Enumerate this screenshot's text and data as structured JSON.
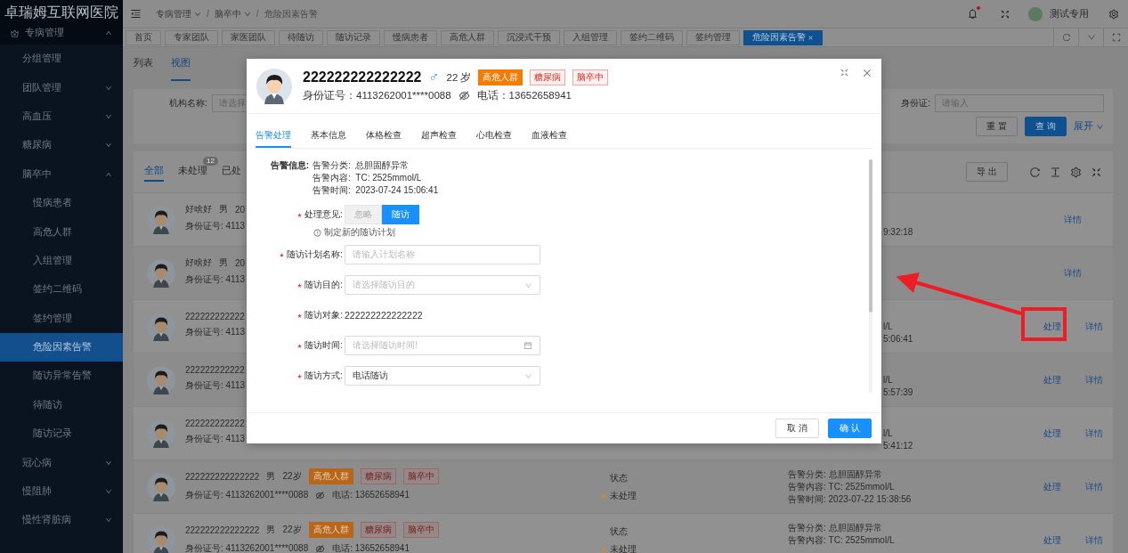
{
  "sidebar": {
    "title": "卓瑞姆互联网医院",
    "items": [
      {
        "label": "专病管理",
        "expanded": true,
        "selected": false,
        "children": [
          {
            "label": "分组管理",
            "selected": false
          },
          {
            "label": "团队管理",
            "expanded": false,
            "selected": false
          },
          {
            "label": "高血压",
            "expanded": false,
            "selected": false
          },
          {
            "label": "糖尿病",
            "expanded": false,
            "selected": false
          },
          {
            "label": "脑卒中",
            "expanded": true,
            "selected": false,
            "children": [
              {
                "label": "慢病患者",
                "selected": false
              },
              {
                "label": "高危人群",
                "selected": false
              },
              {
                "label": "入组管理",
                "selected": false
              },
              {
                "label": "签约二维码",
                "selected": false
              },
              {
                "label": "签约管理",
                "selected": false
              },
              {
                "label": "危险因素告警",
                "selected": true
              },
              {
                "label": "随访异常告警",
                "selected": false
              },
              {
                "label": "待随访",
                "selected": false
              },
              {
                "label": "随访记录",
                "selected": false
              }
            ]
          },
          {
            "label": "冠心病",
            "expanded": false,
            "selected": false
          },
          {
            "label": "慢阻肺",
            "expanded": false,
            "selected": false
          },
          {
            "label": "慢性肾脏病",
            "expanded": false,
            "selected": false
          }
        ]
      }
    ]
  },
  "header": {
    "breadcrumb": [
      {
        "label": "专病管理",
        "dropdown": true
      },
      {
        "separator": "/",
        "label": "脑卒中",
        "dropdown": true
      },
      {
        "separator": "/",
        "label": "危险因素告警",
        "dropdown": false
      }
    ],
    "notification": true,
    "user": "测试专用",
    "tabs": [
      {
        "label": "首页",
        "selected": false
      },
      {
        "label": "专家团队",
        "selected": false
      },
      {
        "label": "家医团队",
        "selected": false
      },
      {
        "label": "待随访",
        "selected": false
      },
      {
        "label": "随访记录",
        "selected": false
      },
      {
        "label": "慢病患者",
        "selected": false
      },
      {
        "label": "高危人群",
        "selected": false
      },
      {
        "label": "沉浸式干预",
        "selected": false
      },
      {
        "label": "入组管理",
        "selected": false
      },
      {
        "label": "签约二维码",
        "selected": false
      },
      {
        "label": "签约管理",
        "selected": false
      },
      {
        "label": "危险因素告警",
        "selected": true
      }
    ]
  },
  "view_tabs": [
    {
      "label": "列表",
      "selected": false
    },
    {
      "label": "视图",
      "selected": true
    }
  ],
  "filter": {
    "fields": [
      {
        "label": "机构名称:",
        "placeholder": "请选择",
        "kind": "select"
      },
      {
        "label": "身份证:",
        "placeholder": "请输入",
        "kind": "input"
      }
    ],
    "buttons": [
      {
        "label": "重 置",
        "primary": false
      },
      {
        "label": "查 询",
        "primary": true
      }
    ],
    "expand": "展开"
  },
  "list": {
    "tabs": [
      {
        "label": "全部",
        "selected": true
      },
      {
        "label": "未处理",
        "selected": false,
        "badge": "12"
      },
      {
        "label": "已处",
        "selected": false
      }
    ],
    "export": "导 出",
    "rows": [
      {
        "kind": "covered",
        "name": "好啥好",
        "gender": "男",
        "age": "20",
        "id": "身份证号: 4113",
        "tail": {
          "time": "9:32:18"
        },
        "actions": [
          "详情"
        ]
      },
      {
        "kind": "covered",
        "name": "好啥好",
        "gender": "男",
        "age": "20",
        "id": "身份证号: 4113",
        "actions": [
          "详情"
        ]
      },
      {
        "kind": "covered",
        "name": "222222222222",
        "id": "身份证号: 4113",
        "tail": {
          "content": "l/L",
          "time": "5:06:41"
        },
        "actions": [
          "处理",
          "详情"
        ]
      },
      {
        "kind": "covered",
        "name": "222222222222",
        "id": "身份证号: 4113",
        "tail": {
          "content": "l/L",
          "time": "5:57:39"
        },
        "actions": [
          "处理",
          "详情"
        ]
      },
      {
        "kind": "covered",
        "name": "222222222222",
        "id": "身份证号: 4113",
        "tail": {
          "content": "l/L",
          "time": "5:41:12"
        },
        "actions": [
          "处理",
          "详情"
        ]
      },
      {
        "kind": "full",
        "name": "222222222222222",
        "gender": "男",
        "age": "22岁",
        "tags": [
          {
            "label": "高危人群",
            "kind": "solid"
          },
          {
            "label": "糖尿病",
            "kind": "outline"
          },
          {
            "label": "脑卒中",
            "kind": "outline"
          }
        ],
        "id": "身份证号: 4113262001****0088",
        "phone": "电话: 13652658941",
        "status_label": "状态",
        "status": "未处理",
        "color": "#c8921c",
        "alert": [
          {
            "label": "告警分类:",
            "value": "总胆固醇异常"
          },
          {
            "label": "告警内容:",
            "value": "TC: 2525mmol/L"
          },
          {
            "label": "告警时间:",
            "value": "2023-07-22 15:38:56"
          }
        ],
        "actions": [
          "处理",
          "详情"
        ]
      },
      {
        "kind": "full",
        "name": "222222222222222",
        "gender": "男",
        "age": "22岁",
        "tags": [
          {
            "label": "高危人群",
            "kind": "solid"
          },
          {
            "label": "糖尿病",
            "kind": "outline"
          },
          {
            "label": "脑卒中",
            "kind": "outline"
          }
        ],
        "id": "身份证号: 4113262001****0088",
        "phone": "电话: 13652658941",
        "status_label": "状态",
        "status": "未处理",
        "color": "#c8921c",
        "alert": [
          {
            "label": "告警分类:",
            "value": "总胆固醇异常"
          },
          {
            "label": "告警内容:",
            "value": "TC: 2525mmol/L"
          }
        ],
        "actions": [
          "处理",
          "详情"
        ]
      }
    ]
  },
  "modal": {
    "patient": {
      "name": "222222222222222",
      "gender": "♂",
      "age": "22 岁",
      "tags": [
        {
          "label": "高危人群",
          "kind": "solid"
        },
        {
          "label": "糖尿病",
          "kind": "outline"
        },
        {
          "label": "脑卒中",
          "kind": "outline"
        }
      ],
      "id": "身份证号：4113262001****0088",
      "phone": "电话：13652658941"
    },
    "tabs": [
      {
        "label": "告警处理",
        "selected": true
      },
      {
        "label": "基本信息",
        "selected": false
      },
      {
        "label": "体格检查",
        "selected": false
      },
      {
        "label": "超声检查",
        "selected": false
      },
      {
        "label": "心电检查",
        "selected": false
      },
      {
        "label": "血液检查",
        "selected": false
      }
    ],
    "alert": {
      "title": "告警信息:",
      "lines": [
        {
          "label": "告警分类:",
          "value": "总胆固醇异常"
        },
        {
          "label": "告警内容:",
          "value": "TC: 2525mmol/L"
        },
        {
          "label": "告警时间:",
          "value": "2023-07-24 15:06:41"
        }
      ]
    },
    "form": [
      {
        "kind": "segmented",
        "label": "处理意见:",
        "required": true,
        "options": [
          {
            "label": "忽略",
            "selected": false
          },
          {
            "label": "随访",
            "selected": true
          }
        ],
        "hint": "制定新的随访计划"
      },
      {
        "kind": "input",
        "label": "随访计划名称:",
        "required": true,
        "placeholder": "请输入计划名称"
      },
      {
        "kind": "select",
        "label": "随访目的:",
        "required": true,
        "placeholder": "请选择随访目的"
      },
      {
        "kind": "text",
        "label": "随访对象:",
        "required": true,
        "value": "222222222222222"
      },
      {
        "kind": "date",
        "label": "随访时间:",
        "required": true,
        "placeholder": "请选择随访时间!"
      },
      {
        "kind": "select",
        "label": "随访方式:",
        "required": true,
        "value": "电话随访"
      }
    ],
    "buttons": [
      {
        "label": "取 消",
        "primary": false
      },
      {
        "label": "确 认",
        "primary": true
      }
    ]
  }
}
